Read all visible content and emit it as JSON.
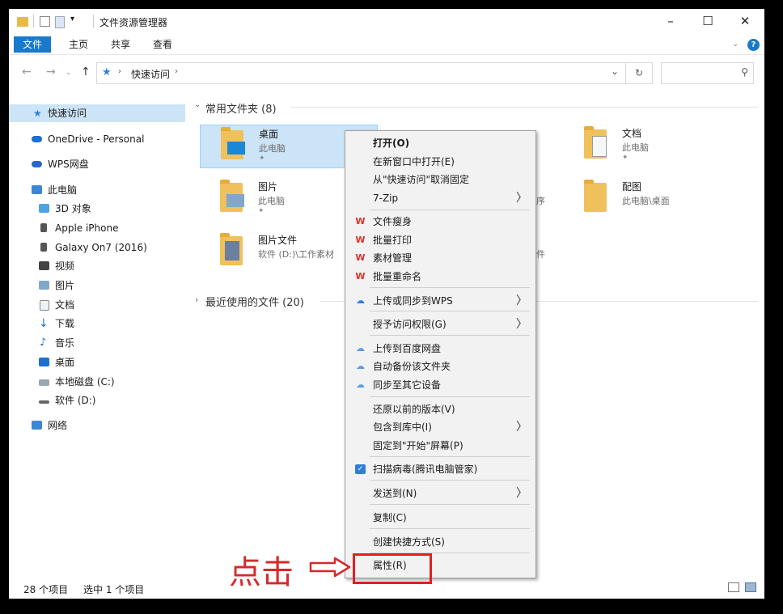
{
  "window": {
    "title": "文件资源管理器",
    "controls": {
      "minimize": "–",
      "maximize": "☐",
      "close": "✕"
    }
  },
  "ribbon": {
    "tabs": [
      "文件",
      "主页",
      "共享",
      "查看"
    ],
    "active_tab_color": "#1979ca"
  },
  "address": {
    "path_segment": "快速访问",
    "refresh_glyph": "↻",
    "dropdown_glyph": "⌄",
    "search_glyph": "⚲"
  },
  "sidebar": {
    "items": [
      {
        "label": "快速访问",
        "icon": "star-icon",
        "selected": true
      },
      {
        "label": "OneDrive - Personal",
        "icon": "cloud-icon"
      },
      {
        "label": "WPS网盘",
        "icon": "wps-cloud-icon"
      },
      {
        "label": "此电脑",
        "icon": "computer-icon"
      },
      {
        "label": "3D 对象",
        "icon": "3d-objects-icon"
      },
      {
        "label": "Apple iPhone",
        "icon": "phone-icon"
      },
      {
        "label": "Galaxy On7 (2016)",
        "icon": "phone-icon"
      },
      {
        "label": "视频",
        "icon": "video-icon"
      },
      {
        "label": "图片",
        "icon": "pictures-icon"
      },
      {
        "label": "文档",
        "icon": "documents-icon"
      },
      {
        "label": "下载",
        "icon": "download-icon"
      },
      {
        "label": "音乐",
        "icon": "music-icon"
      },
      {
        "label": "桌面",
        "icon": "desktop-icon"
      },
      {
        "label": "本地磁盘 (C:)",
        "icon": "drive-icon"
      },
      {
        "label": "软件 (D:)",
        "icon": "drive-icon"
      },
      {
        "label": "网络",
        "icon": "network-icon"
      }
    ]
  },
  "main": {
    "group_frequent": "常用文件夹 (8)",
    "group_recent": "最近使用的文件 (20)",
    "folders": [
      {
        "name": "桌面",
        "sub": "此电脑"
      },
      {
        "name": "文档",
        "sub": "此电脑"
      },
      {
        "name": "图片",
        "sub": "此电脑"
      },
      {
        "name": "配图",
        "sub": "此电脑\\桌面"
      },
      {
        "name": "图片文件",
        "sub": "软件 (D:)\\工作素材"
      }
    ],
    "partial_texts": [
      "序",
      "件"
    ]
  },
  "context_menu": {
    "items": {
      "open": "打开(O)",
      "open_new_window": "在新窗口中打开(E)",
      "unpin": "从\"快速访问\"取消固定",
      "zip": "7-Zip",
      "wps_slim": "文件瘦身",
      "wps_print": "批量打印",
      "wps_material": "素材管理",
      "wps_rename": "批量重命名",
      "wps_upload": "上传或同步到WPS",
      "grant_access": "授予访问权限(G)",
      "baidu_upload": "上传到百度网盘",
      "baidu_backup": "自动备份该文件夹",
      "baidu_sync": "同步至其它设备",
      "restore": "还原以前的版本(V)",
      "include_library": "包含到库中(I)",
      "pin_start": "固定到\"开始\"屏幕(P)",
      "scan": "扫描病毒(腾讯电脑管家)",
      "send_to": "发送到(N)",
      "copy": "复制(C)",
      "shortcut": "创建快捷方式(S)",
      "properties": "属性(R)"
    },
    "submenu_glyph": "〉"
  },
  "annotation": {
    "text": "点击",
    "color": "#d42b2b"
  },
  "status": {
    "count": "28 个项目",
    "selected": "选中 1 个项目"
  }
}
